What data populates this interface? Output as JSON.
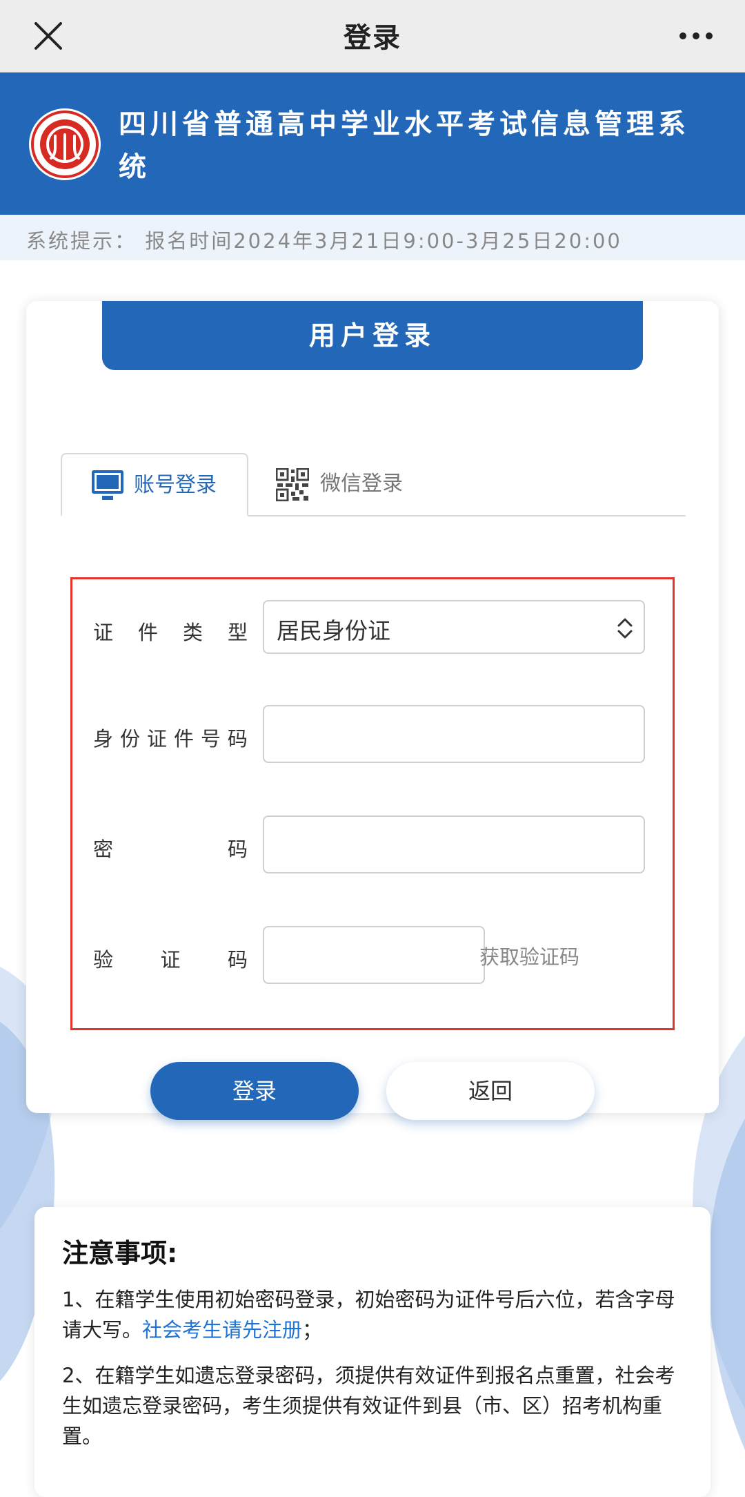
{
  "navbar": {
    "title": "登录"
  },
  "header": {
    "system_title": "四川省普通高中学业水平考试信息管理系统"
  },
  "notice": {
    "text": "系统提示：  报名时间2024年3月21日9:00-3月25日20:00"
  },
  "card": {
    "banner": "用户登录",
    "tabs": [
      {
        "label": "账号登录",
        "icon": "monitor-icon"
      },
      {
        "label": "微信登录",
        "icon": "qr-code-icon"
      }
    ],
    "form": {
      "id_type": {
        "label": [
          "证",
          "件",
          "类",
          "型"
        ],
        "value": "居民身份证"
      },
      "id_number": {
        "label": [
          "身",
          "份",
          "证",
          "件",
          "号",
          "码"
        ],
        "value": ""
      },
      "password": {
        "label": [
          "密",
          "码"
        ],
        "value": ""
      },
      "captcha": {
        "label": [
          "验",
          "证",
          "码"
        ],
        "value": ""
      },
      "get_code": "获取验证码"
    },
    "buttons": {
      "login": "登录",
      "back": "返回"
    }
  },
  "notes": {
    "title": "注意事项:",
    "item1_text": "1、在籍学生使用初始密码登录，初始密码为证件号后六位，若含字母请大写。",
    "item1_link": "社会考生请先注册",
    "item1_end": "；",
    "item2_text": "2、在籍学生如遗忘登录密码，须提供有效证件到报名点重置，社会考生如遗忘登录密码，考生须提供有效证件到县（市、区）招考机构重置。"
  },
  "colors": {
    "brand_blue": "#2367b8",
    "alert_red": "#e5332a",
    "link_blue": "#1f72d6"
  }
}
